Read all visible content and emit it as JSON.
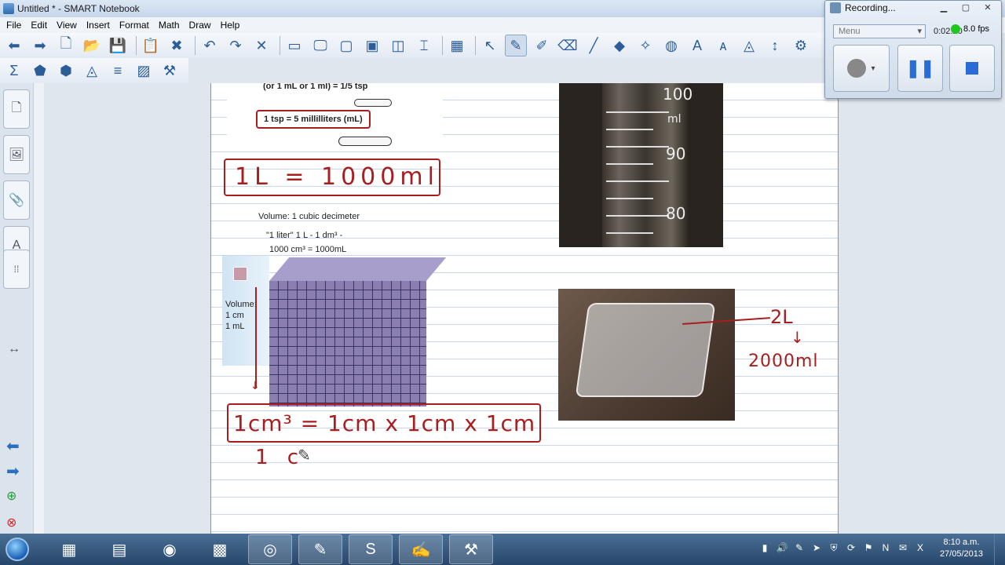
{
  "window": {
    "title": "Untitled * - SMART Notebook"
  },
  "menu": [
    "File",
    "Edit",
    "View",
    "Insert",
    "Format",
    "Math",
    "Draw",
    "Help"
  ],
  "toolbar1": [
    {
      "icon": "back-arrow-icon",
      "glyph": "⬅"
    },
    {
      "icon": "forward-arrow-icon",
      "glyph": "➡"
    },
    {
      "icon": "add-page-icon",
      "glyph": "🗋"
    },
    {
      "icon": "open-folder-icon",
      "glyph": "📂"
    },
    {
      "icon": "save-icon",
      "glyph": "💾"
    },
    {
      "icon": "paste-icon",
      "glyph": "📋"
    },
    {
      "icon": "delete-page-icon",
      "glyph": "✖"
    },
    {
      "icon": "undo-icon",
      "glyph": "↶"
    },
    {
      "icon": "redo-icon",
      "glyph": "↷"
    },
    {
      "icon": "delete-icon",
      "glyph": "✕"
    },
    {
      "icon": "screen-shade-icon",
      "glyph": "▭"
    },
    {
      "icon": "full-screen-icon",
      "glyph": "🖵"
    },
    {
      "icon": "transparent-background-icon",
      "glyph": "▢"
    },
    {
      "icon": "dual-page-icon",
      "glyph": "▣"
    },
    {
      "icon": "screen-capture-icon",
      "glyph": "◫"
    },
    {
      "icon": "document-camera-icon",
      "glyph": "⌶"
    },
    {
      "icon": "table-icon",
      "glyph": "▦"
    },
    {
      "icon": "select-icon",
      "glyph": "↖"
    },
    {
      "icon": "pen-icon",
      "glyph": "✎"
    },
    {
      "icon": "creative-pen-icon",
      "glyph": "✐"
    },
    {
      "icon": "eraser-icon",
      "glyph": "⌫"
    },
    {
      "icon": "line-icon",
      "glyph": "╱"
    },
    {
      "icon": "shapes-icon",
      "glyph": "◆"
    },
    {
      "icon": "magic-pen-icon",
      "glyph": "✧"
    },
    {
      "icon": "fill-icon",
      "glyph": "◍"
    },
    {
      "icon": "text-icon",
      "glyph": "A"
    },
    {
      "icon": "text-recognition-icon",
      "glyph": "ᴀ"
    },
    {
      "icon": "measurement-tools-icon",
      "glyph": "◬"
    },
    {
      "icon": "move-toolbar-icon",
      "glyph": "↕"
    },
    {
      "icon": "customize-icon",
      "glyph": "⚙"
    }
  ],
  "toolbar2": [
    {
      "icon": "sum-icon",
      "glyph": "Σ"
    },
    {
      "icon": "geometry-icon",
      "glyph": "⬟"
    },
    {
      "icon": "shape-icon",
      "glyph": "⬢"
    },
    {
      "icon": "compass-icon",
      "glyph": "◬"
    },
    {
      "icon": "equation-icon",
      "glyph": "≡"
    },
    {
      "icon": "graph-icon",
      "glyph": "▨"
    },
    {
      "icon": "math-tools-icon",
      "glyph": "⚒"
    }
  ],
  "side_tabs": [
    {
      "icon": "page-sorter-icon",
      "glyph": "🗋"
    },
    {
      "icon": "gallery-icon",
      "glyph": "🖼"
    },
    {
      "icon": "attachments-icon",
      "glyph": "📎"
    },
    {
      "icon": "properties-icon",
      "glyph": "A"
    }
  ],
  "page": {
    "printed_top": "(or 1 mL or 1 ml) = 1/5 tsp",
    "printed_tsp": "1 tsp = 5 millilliters (mL)",
    "handwritten_liter": "1L = 1000ml",
    "printed_volume_title": "Volume: 1 cubic decimeter",
    "printed_liter_line1": "\"1 liter\"   1 L - 1 dm³ -",
    "printed_liter_line2": "1000 cm³ = 1000mL",
    "printed_small_volume": "Volume:",
    "printed_small_cm": "1 cm",
    "printed_small_ml": "1 mL",
    "handwritten_cubic": "1cm³ = 1cm x 1cm x 1cm",
    "handwritten_partial": "1 c",
    "cylinder_labels": [
      "100",
      "ml",
      "90",
      "80"
    ],
    "handwritten_2l": "2L",
    "handwritten_2000": "2000ml"
  },
  "recorder": {
    "title": "Recording...",
    "menu_label": "Menu",
    "time": "0:02:20",
    "fps": "8.0 fps"
  },
  "taskbar": {
    "apps": [
      {
        "icon": "calculator-icon",
        "glyph": "▦"
      },
      {
        "icon": "explorer-icon",
        "glyph": "▤"
      },
      {
        "icon": "firefox-icon",
        "glyph": "◉"
      },
      {
        "icon": "calculator2-icon",
        "glyph": "▩"
      },
      {
        "icon": "chrome-icon",
        "glyph": "◎"
      },
      {
        "icon": "notebook-tools-icon",
        "glyph": "✎"
      },
      {
        "icon": "skype-icon",
        "glyph": "S"
      },
      {
        "icon": "smart-notebook-icon",
        "glyph": "✍"
      },
      {
        "icon": "smart-recorder-icon",
        "glyph": "⚒"
      }
    ],
    "time": "8:10 a.m.",
    "date": "27/05/2013"
  }
}
